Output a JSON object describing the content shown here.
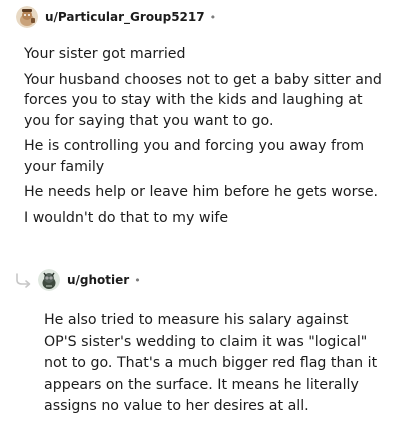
{
  "comment": {
    "username": "u/Particular_Group5217",
    "separator": "•",
    "paragraphs": [
      "Your sister got married",
      "Your husband chooses not to get a baby sitter and forces you to stay with the kids and laughing at you for saying that you want to go.",
      "He is controlling you and forcing you away from your family",
      "He needs help or leave him before he gets worse.",
      "I wouldn't do that to my wife"
    ]
  },
  "reply": {
    "username": "u/ghotier",
    "separator": "•",
    "paragraphs": [
      "He also tried to measure his salary against OP'S sister's wedding to claim it was \"logical\" not to go. That's a much bigger red flag than it appears on the surface. It means he literally assigns no value to her desires at all."
    ]
  },
  "icons": {
    "reply_arrow": "reply-arrow-icon",
    "avatar1": "snoo-avatar-icon",
    "avatar2": "snoo-avatar-icon"
  },
  "colors": {
    "text": "#1c1c1c",
    "muted": "#7c7c7c",
    "thread_line": "#c7c7c7"
  }
}
